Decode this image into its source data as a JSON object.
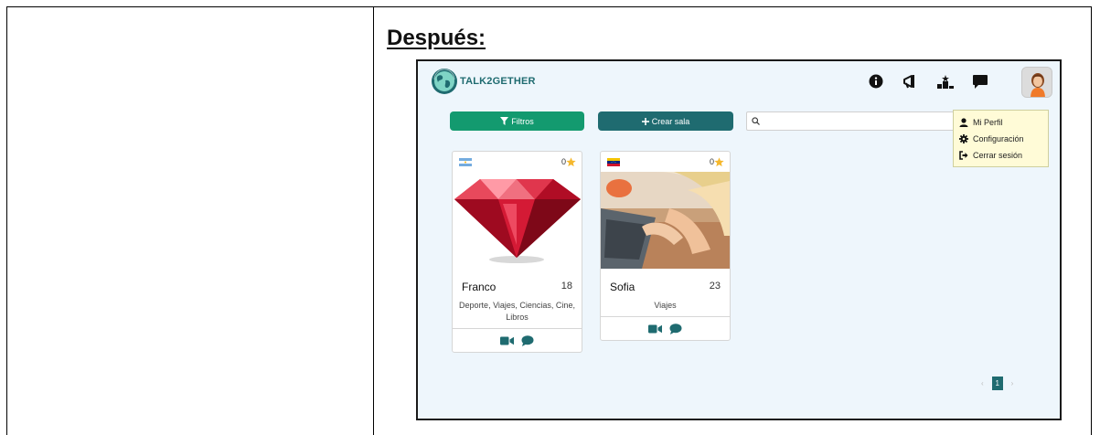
{
  "document": {
    "heading": "Después:"
  },
  "app": {
    "brand": "TALK2GETHER",
    "header_icons": [
      "info-icon",
      "megaphone-icon",
      "ranking-icon",
      "chat-icon"
    ],
    "filters_label": "Filtros",
    "create_room_label": "Crear sala",
    "search": {
      "value": "",
      "placeholder": ""
    },
    "user_menu": {
      "items": [
        {
          "label": "Mi Perfil",
          "icon": "user-icon"
        },
        {
          "label": "Configuración",
          "icon": "gear-icon"
        },
        {
          "label": "Cerrar sesión",
          "icon": "logout-icon"
        }
      ]
    },
    "cards": [
      {
        "flag": "argentina",
        "likes": "0",
        "name": "Franco",
        "age": "18",
        "interests": "Deporte, Viajes, Ciencias, Cine, Libros"
      },
      {
        "flag": "venezuela",
        "likes": "0",
        "name": "Sofia",
        "age": "23",
        "interests": "Viajes"
      }
    ],
    "pagination": {
      "prev": "‹",
      "current": "1",
      "next": "›"
    }
  },
  "colors": {
    "green": "#139a6f",
    "teal": "#1f6b70",
    "app_background": "#eef6fc",
    "menu_background": "#fffbd7",
    "star": "#f5b82e"
  }
}
